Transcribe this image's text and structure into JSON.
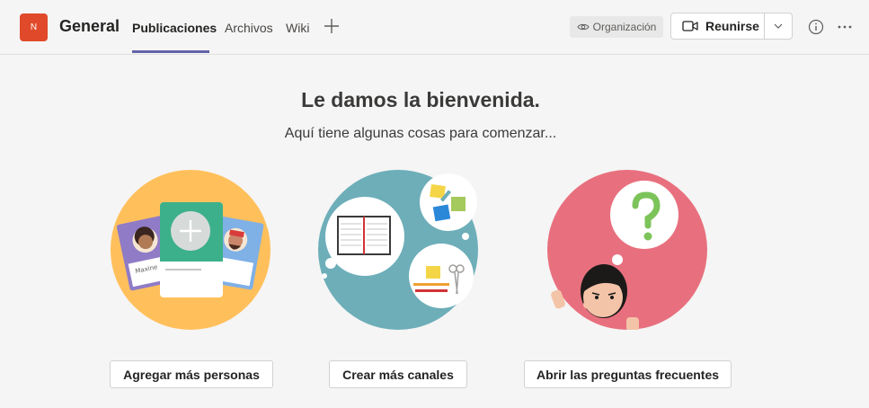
{
  "header": {
    "team_initial": "N",
    "channel_name": "General",
    "tabs": [
      {
        "label": "Publicaciones",
        "active": true
      },
      {
        "label": "Archivos",
        "active": false
      },
      {
        "label": "Wiki",
        "active": false
      }
    ],
    "org_badge": "Organización",
    "meet_label": "Reunirse"
  },
  "welcome": {
    "title": "Le damos la bienvenida.",
    "subtitle": "Aquí tiene algunas cosas para comenzar..."
  },
  "actions": [
    {
      "label": "Agregar más personas",
      "illustration": "people-cards-illustration"
    },
    {
      "label": "Crear más canales",
      "illustration": "channels-illustration"
    },
    {
      "label": "Abrir las preguntas frecuentes",
      "illustration": "faq-illustration"
    }
  ],
  "illustration_text": {
    "card_left_name": "Maxine",
    "card_right_name": "ky"
  },
  "colors": {
    "accent": "#6264a7",
    "team_avatar": "#e04a2a",
    "circle_people": "#ffc05c",
    "circle_channels": "#6daeb9",
    "circle_faq": "#e8707e"
  }
}
